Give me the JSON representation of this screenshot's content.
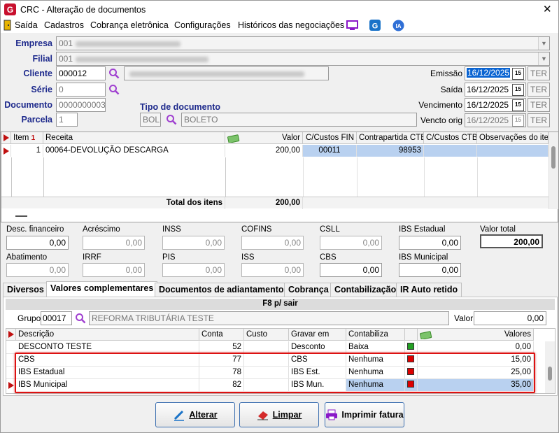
{
  "window": {
    "title": "CRC - Alteração de documentos"
  },
  "menu": [
    "Saída",
    "Cadastros",
    "Cobrança eletrônica",
    "Configurações",
    "Históricos das negociações"
  ],
  "menu_icons": {
    "ia_label": "IA"
  },
  "header": {
    "empresa_label": "Empresa",
    "empresa_value": "001",
    "filial_label": "Filial",
    "filial_value": "001",
    "cliente_label": "Cliente",
    "cliente_value": "000012",
    "serie_label": "Série",
    "serie_value": "0",
    "documento_label": "Documento",
    "documento_value": "0000000003",
    "parcela_label": "Parcela",
    "parcela_value": "1",
    "tipo_label": "Tipo de documento",
    "tipo_code": "BOL",
    "tipo_desc": "BOLETO",
    "emissao_label": "Emissão",
    "emissao_value": "16/12/2025",
    "emissao_day": "TER",
    "saida_label": "Saída",
    "saida_value": "16/12/2025",
    "saida_day": "TER",
    "vencimento_label": "Vencimento",
    "vencimento_value": "16/12/2025",
    "vencimento_day": "TER",
    "vencto_orig_label": "Vencto orig",
    "vencto_orig_value": "16/12/2025",
    "vencto_orig_day": "TER",
    "cal_label": "15"
  },
  "items_grid": {
    "headers": {
      "item": "Item",
      "sort": "1",
      "receita": "Receita",
      "valor": "Valor",
      "ccfin": "C/Custos FIN",
      "contrapartida": "Contrapartida CTB",
      "ccctb": "C/Custos CTB",
      "obs": "Observações do item"
    },
    "rows": [
      {
        "item": "1",
        "receita": "00064-DEVOLUÇÃO  DESCARGA",
        "valor": "200,00",
        "ccfin": "00011",
        "contrapartida": "98953",
        "ccctb": "",
        "obs": ""
      }
    ],
    "total_label": "Total dos itens",
    "total_value": "200,00"
  },
  "fields": {
    "desc_fin": {
      "label": "Desc. financeiro",
      "value": "0,00"
    },
    "acrescimo": {
      "label": "Acréscimo",
      "value": "0,00"
    },
    "inss": {
      "label": "INSS",
      "value": "0,00"
    },
    "cofins": {
      "label": "COFINS",
      "value": "0,00"
    },
    "csll": {
      "label": "CSLL",
      "value": "0,00"
    },
    "ibs_estadual": {
      "label": "IBS Estadual",
      "value": "0,00"
    },
    "valor_total": {
      "label": "Valor total",
      "value": "200,00"
    },
    "abatimento": {
      "label": "Abatimento",
      "value": "0,00"
    },
    "irrf": {
      "label": "IRRF",
      "value": "0,00"
    },
    "pis": {
      "label": "PIS",
      "value": "0,00"
    },
    "iss": {
      "label": "ISS",
      "value": "0,00"
    },
    "cbs": {
      "label": "CBS",
      "value": "0,00"
    },
    "ibs_municipal": {
      "label": "IBS Municipal",
      "value": "0,00"
    }
  },
  "tabs": [
    "Diversos",
    "Valores complementares",
    "Documentos de adiantamento",
    "Cobrança",
    "Contabilização",
    "IR Auto retido"
  ],
  "complementares": {
    "f8_label": "F8 p/ sair",
    "grupo_label": "Grupo",
    "grupo_code": "00017",
    "grupo_desc": "REFORMA TRIBUTÁRIA TESTE",
    "valor_label": "Valor",
    "valor_value": "0,00",
    "headers": {
      "descricao": "Descrição",
      "conta": "Conta",
      "custo": "Custo",
      "gravar": "Gravar em",
      "contabiliza": "Contabiliza",
      "valores": "Valores"
    },
    "rows": [
      {
        "descricao": "DESCONTO TESTE",
        "conta": "52",
        "custo": "",
        "gravar": "Desconto",
        "contabiliza": "Baixa",
        "flag": "green",
        "valor": "0,00"
      },
      {
        "descricao": "CBS",
        "conta": "77",
        "custo": "",
        "gravar": "CBS",
        "contabiliza": "Nenhuma",
        "flag": "red",
        "valor": "15,00"
      },
      {
        "descricao": "IBS Estadual",
        "conta": "78",
        "custo": "",
        "gravar": "IBS Est.",
        "contabiliza": "Nenhuma",
        "flag": "red",
        "valor": "25,00"
      },
      {
        "descricao": "IBS Municipal",
        "conta": "82",
        "custo": "",
        "gravar": "IBS Mun.",
        "contabiliza": "Nenhuma",
        "flag": "red",
        "valor": "35,00"
      }
    ]
  },
  "buttons": {
    "alterar": "Alterar",
    "limpar": "Limpar",
    "imprimir": "Imprimir fatura"
  },
  "colors": {
    "label_blue": "#1e2a8c",
    "selection": "#b9d1f0",
    "highlight": "#d11",
    "flag_green": "#22a022",
    "flag_red": "#d00"
  }
}
